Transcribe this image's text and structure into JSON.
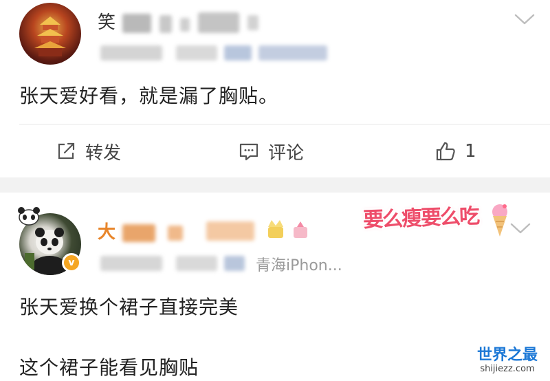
{
  "comments": [
    {
      "user_name": "笑",
      "meta_text": "",
      "content": "张天爱好看，就是漏了胸贴。",
      "actions": {
        "repost_label": "转发",
        "comment_label": "评论",
        "like_count": "1"
      }
    },
    {
      "user_name": "大",
      "meta_text": "青海iPhon...",
      "sticker_text": "要么瘦要么吃",
      "verified_badge": "v",
      "content_lines": [
        "张天爱换个裙子直接完美",
        "这个裙子能看见胸贴"
      ]
    }
  ],
  "watermark": {
    "main": "世界之最",
    "sub": "shijiezz.com"
  },
  "colors": {
    "vip_name": "#e8852a",
    "verified": "#f5a623",
    "separator": "#f2f2f2",
    "watermark": "#1c78d6"
  },
  "icons": [
    "chevron-down-icon",
    "repost-icon",
    "comment-icon",
    "like-icon",
    "verified-icon",
    "ice-cream-icon"
  ]
}
